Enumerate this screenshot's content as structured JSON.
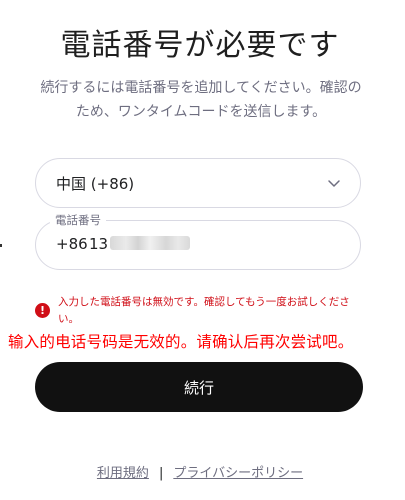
{
  "header": {
    "title": "電話番号が必要です",
    "subtitle": "続行するには電話番号を追加してください。確認のため、ワンタイムコードを送信します。"
  },
  "country_select": {
    "value": "中国 (+86)",
    "icon": "chevron-down-icon"
  },
  "phone_input": {
    "label": "電話番号",
    "prefix": "+86",
    "value": "13"
  },
  "error": {
    "icon": "error-icon",
    "message": "入力した電話番号は無効です。確認してもう一度お試しください。",
    "color": "#d00e17"
  },
  "annotation": {
    "text": "输入的电话号码是无效的。请确认后再次尝试吧。",
    "color": "#ff0000"
  },
  "actions": {
    "continue_label": "続行",
    "button_color": "#111111"
  },
  "footer": {
    "terms_label": "利用規約",
    "separator": "|",
    "privacy_label": "プライバシーポリシー"
  }
}
